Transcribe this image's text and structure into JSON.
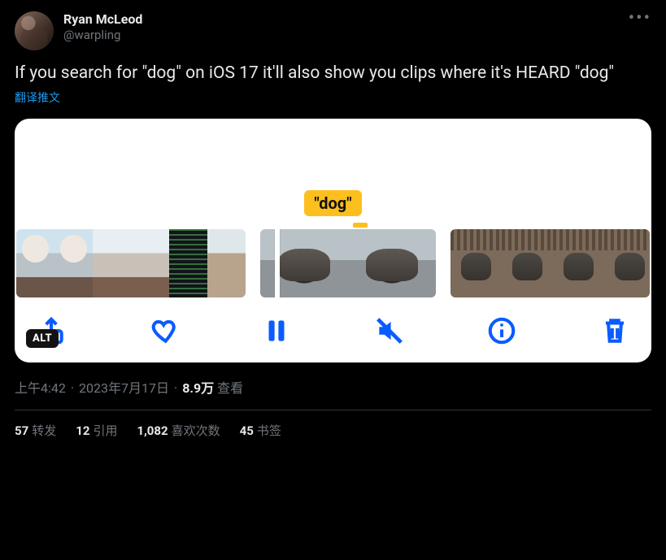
{
  "author": {
    "display_name": "Ryan McLeod",
    "handle": "@warpling"
  },
  "body_text": "If you search for \"dog\" on iOS 17 it'll also show you clips where it's HEARD \"dog\"",
  "translate_label": "翻译推文",
  "media": {
    "keyword_tag": "\"dog\"",
    "alt_badge": "ALT"
  },
  "meta": {
    "time": "上午4:42",
    "date": "2023年7月17日",
    "views_count": "8.9万",
    "views_label": "查看"
  },
  "stats": {
    "retweets_count": "57",
    "retweets_label": "转发",
    "quotes_count": "12",
    "quotes_label": "引用",
    "likes_count": "1,082",
    "likes_label": "喜欢次数",
    "bookmarks_count": "45",
    "bookmarks_label": "书签"
  }
}
